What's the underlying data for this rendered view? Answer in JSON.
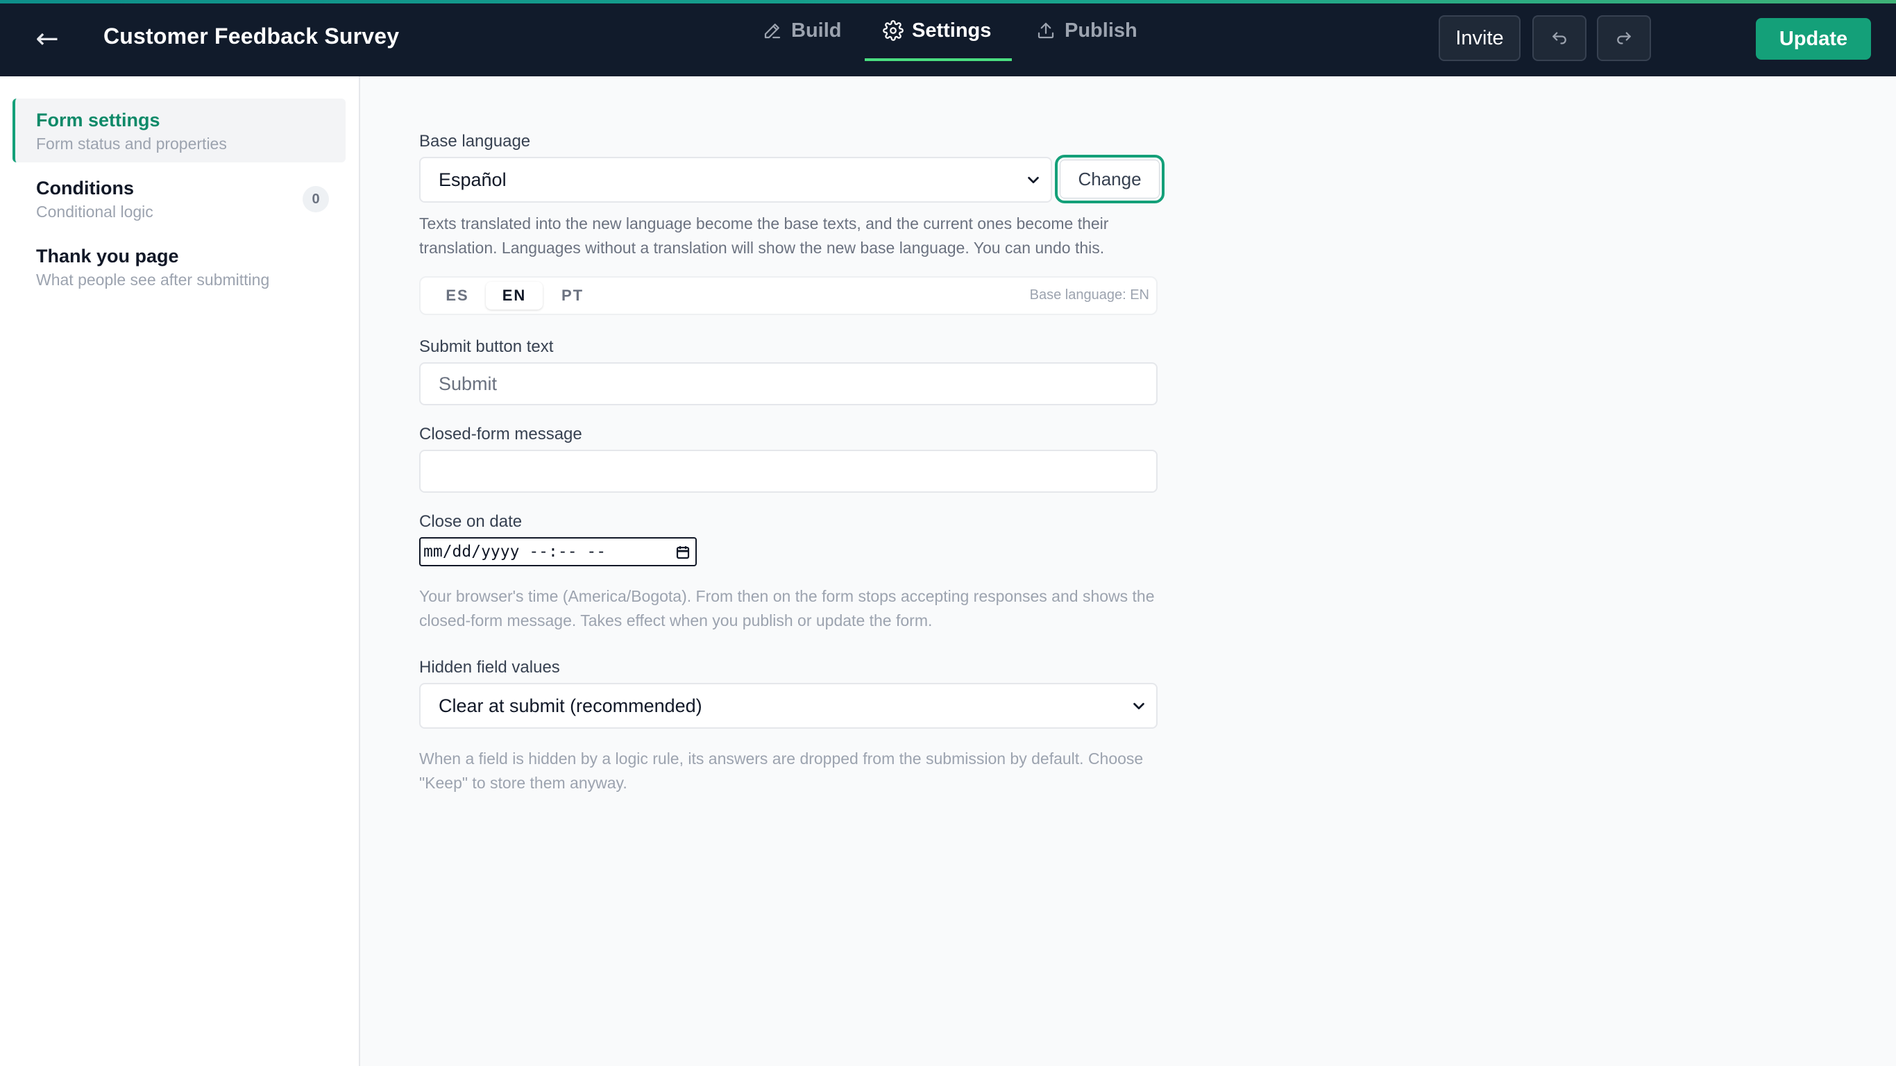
{
  "header": {
    "back_icon": "arrow-left-icon",
    "title": "Customer Feedback Survey",
    "tabs": [
      {
        "label": "Build",
        "icon": "pencil-icon"
      },
      {
        "label": "Settings",
        "icon": "gear-icon",
        "active": true
      },
      {
        "label": "Publish",
        "icon": "upload-icon"
      }
    ],
    "invite_label": "Invite",
    "undo_icon": "undo-icon",
    "redo_icon": "redo-icon",
    "update_label": "Update"
  },
  "sidebar": {
    "items": [
      {
        "label": "Form settings",
        "desc": "Form status and properties",
        "active": true
      },
      {
        "label": "Conditions",
        "desc": "Conditional logic",
        "count": "0"
      },
      {
        "label": "Thank you page",
        "desc": "What people see after submitting"
      }
    ]
  },
  "main": {
    "base_language": {
      "label": "Base language",
      "value": "Español",
      "change_label": "Change",
      "help": "Texts translated into the new language become the base texts, and the current ones become their translation. Languages without a translation will show the new base language. You can undo this."
    },
    "languages": {
      "tabs": [
        "ES",
        "EN",
        "PT"
      ],
      "active": "EN",
      "note": "Base language: EN"
    },
    "submit_text": {
      "label": "Submit button text",
      "placeholder": "Submit",
      "value": ""
    },
    "closed_message": {
      "label": "Closed-form message",
      "value": ""
    },
    "close_date": {
      "label": "Close on date",
      "placeholder": "mm/dd/yyyy --:-- --",
      "help": "Your browser's time (America/Bogota). From then on the form stops accepting responses and shows the closed-form message. Takes effect when you publish or update the form."
    },
    "hidden_fields": {
      "label": "Hidden field values",
      "value": "Clear at submit (recommended)",
      "help": "When a field is hidden by a logic rule, its answers are dropped from the submission by default. Choose \"Keep\" to store them anyway."
    }
  },
  "colors": {
    "header_bg": "#111b2b",
    "accent_green": "#14a079",
    "active_tab_underline": "#4ade80"
  }
}
